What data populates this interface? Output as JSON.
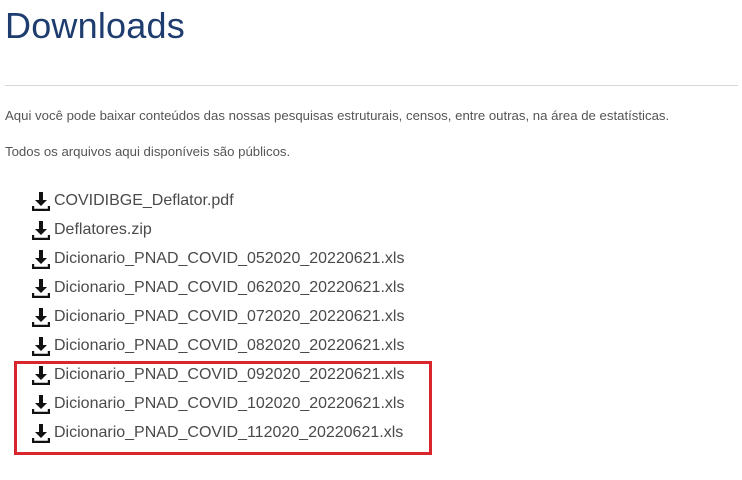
{
  "page": {
    "title": "Downloads",
    "intro": "Aqui você pode baixar conteúdos das nossas pesquisas estruturais, censos, entre outras, na área de estatísticas.",
    "note": "Todos os arquivos aqui disponíveis são públicos."
  },
  "files": [
    {
      "name": "COVIDIBGE_Deflator.pdf",
      "icon": "download-icon"
    },
    {
      "name": "Deflatores.zip",
      "icon": "download-icon"
    },
    {
      "name": "Dicionario_PNAD_COVID_052020_20220621.xls",
      "icon": "download-icon"
    },
    {
      "name": "Dicionario_PNAD_COVID_062020_20220621.xls",
      "icon": "download-icon"
    },
    {
      "name": "Dicionario_PNAD_COVID_072020_20220621.xls",
      "icon": "download-icon"
    },
    {
      "name": "Dicionario_PNAD_COVID_082020_20220621.xls",
      "icon": "download-icon"
    },
    {
      "name": "Dicionario_PNAD_COVID_092020_20220621.xls",
      "icon": "download-icon"
    },
    {
      "name": "Dicionario_PNAD_COVID_102020_20220621.xls",
      "icon": "download-icon"
    },
    {
      "name": "Dicionario_PNAD_COVID_112020_20220621.xls",
      "icon": "download-icon"
    }
  ],
  "colors": {
    "title": "#1e3c6e",
    "highlight": "#d9262e",
    "icon": "#111111"
  }
}
